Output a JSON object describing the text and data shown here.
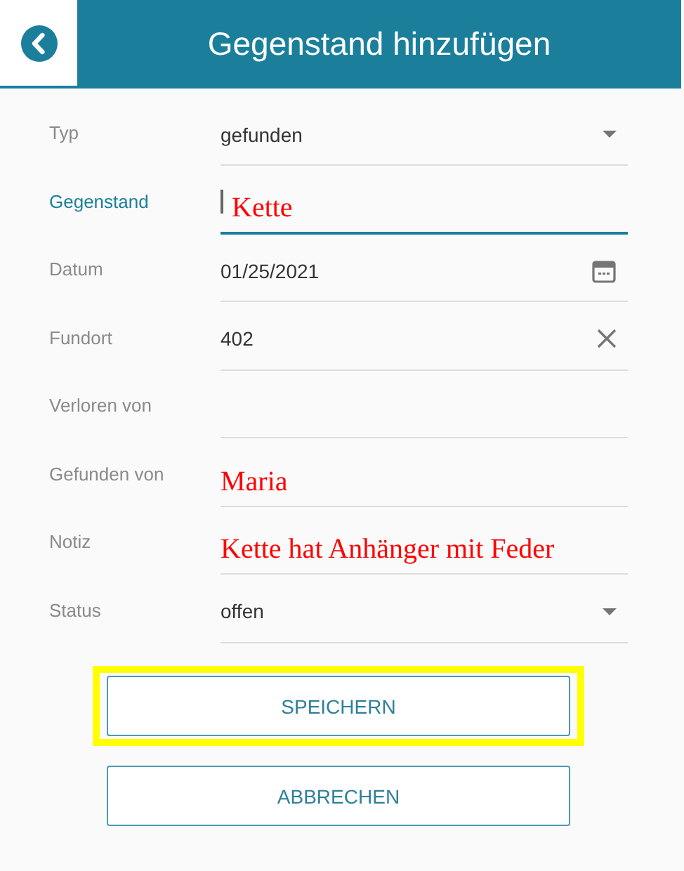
{
  "header": {
    "title": "Gegenstand hinzufügen"
  },
  "fields": [
    {
      "label": "Typ",
      "kind": "select",
      "value": "gefunden",
      "focused": false,
      "handwritten": false
    },
    {
      "label": "Gegenstand",
      "kind": "text",
      "value": "Kette",
      "focused": true,
      "handwritten": true
    },
    {
      "label": "Datum",
      "kind": "date",
      "value": "01/25/2021",
      "focused": false,
      "handwritten": false
    },
    {
      "label": "Fundort",
      "kind": "clearable",
      "value": "402",
      "focused": false,
      "handwritten": false
    },
    {
      "label": "Verloren von",
      "kind": "text",
      "focused": false
    },
    {
      "label": "Gefunden von",
      "kind": "text",
      "value": "Maria",
      "focused": false,
      "handwritten": true
    },
    {
      "label": "Notiz",
      "kind": "text",
      "value": "Kette hat Anhänger mit Feder",
      "focused": false,
      "handwritten": true
    },
    {
      "label": "Status",
      "kind": "select",
      "value": "offen",
      "focused": false,
      "handwritten": false
    }
  ],
  "buttons": [
    {
      "label": "SPEICHERN",
      "highlighted": true
    },
    {
      "label": "ABBRECHEN",
      "highlighted": false
    }
  ]
}
